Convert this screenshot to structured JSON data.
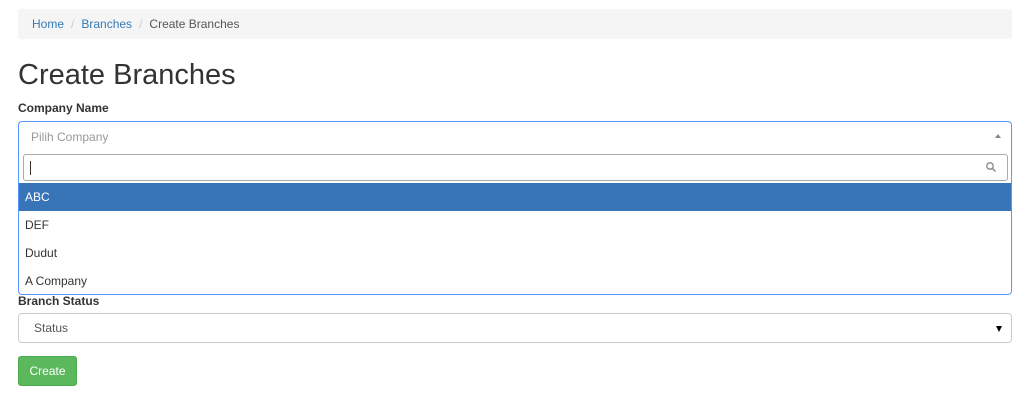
{
  "breadcrumb": {
    "items": [
      {
        "label": "Home"
      },
      {
        "label": "Branches"
      },
      {
        "label": "Create Branches"
      }
    ],
    "separator": "/"
  },
  "page_title": "Create Branches",
  "form": {
    "company_label": "Company Name",
    "company_placeholder": "Pilih Company",
    "company_search_value": "",
    "company_options": [
      "ABC",
      "DEF",
      "Dudut",
      "A Company"
    ],
    "company_highlighted": "ABC",
    "status_label": "Branch Status",
    "status_value": "Status",
    "create_label": "Create"
  },
  "colors": {
    "link": "#337ab7",
    "highlight": "#3875b8",
    "focus_border": "#5897fb",
    "create_button": "#5cb85c"
  },
  "icons": {
    "search": "search-icon",
    "dropdown_open": "arrow-up-icon",
    "status_caret": "caret-down-icon"
  }
}
